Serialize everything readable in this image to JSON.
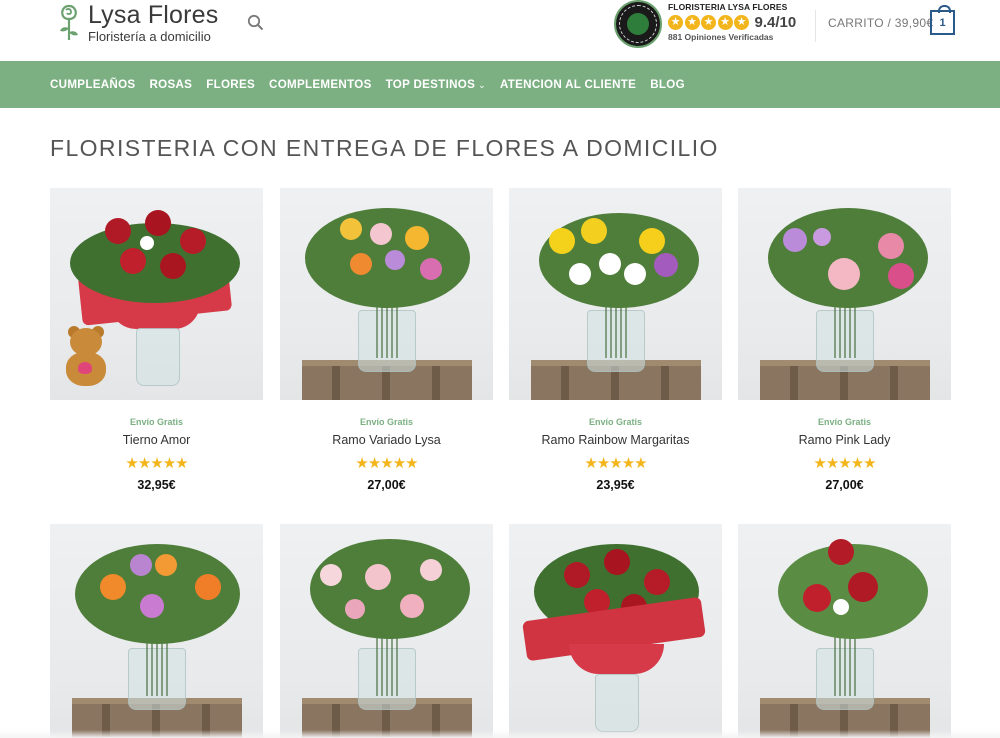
{
  "header": {
    "logo_name": "Lysa Flores",
    "logo_tagline": "Floristería a domicilio",
    "reviews_title": "FLORISTERIA LYSA FLORES",
    "reviews_score": "9.4/10",
    "reviews_count": "881 Opiniones Verificadas",
    "cart_label": "CARRITO / 39,90€",
    "cart_count": "1",
    "icons": {
      "search": "search-icon",
      "cart": "cart-icon",
      "seal": "certificate-seal-icon",
      "logo": "rose-logo-icon"
    }
  },
  "nav": {
    "items": [
      {
        "label": "CUMPLEAÑOS"
      },
      {
        "label": "ROSAS"
      },
      {
        "label": "FLORES"
      },
      {
        "label": "COMPLEMENTOS"
      },
      {
        "label": "TOP DESTINOS",
        "has_dropdown": true
      },
      {
        "label": "ATENCION AL CLIENTE"
      },
      {
        "label": "BLOG"
      }
    ]
  },
  "main": {
    "title": "FLORISTERIA CON ENTREGA DE FLORES A DOMICILIO",
    "products": [
      {
        "badge": "Envío Gratis",
        "name": "Tierno Amor",
        "rating": 5,
        "price": "32,95€"
      },
      {
        "badge": "Envío Gratis",
        "name": "Ramo Variado Lysa",
        "rating": 5,
        "price": "27,00€"
      },
      {
        "badge": "Envío Gratis",
        "name": "Ramo Rainbow Margaritas",
        "rating": 5,
        "price": "23,95€"
      },
      {
        "badge": "Envío Gratis",
        "name": "Ramo Pink Lady",
        "rating": 5,
        "price": "27,00€"
      },
      {
        "badge": "",
        "name": "",
        "rating": 0,
        "price": ""
      },
      {
        "badge": "",
        "name": "",
        "rating": 0,
        "price": ""
      },
      {
        "badge": "",
        "name": "",
        "rating": 0,
        "price": ""
      },
      {
        "badge": "",
        "name": "",
        "rating": 0,
        "price": ""
      }
    ]
  },
  "colors": {
    "nav_bg": "#7cb083",
    "accent_green": "#7cb083",
    "star": "#f2b51b",
    "cart_border": "#2a5a8a"
  }
}
